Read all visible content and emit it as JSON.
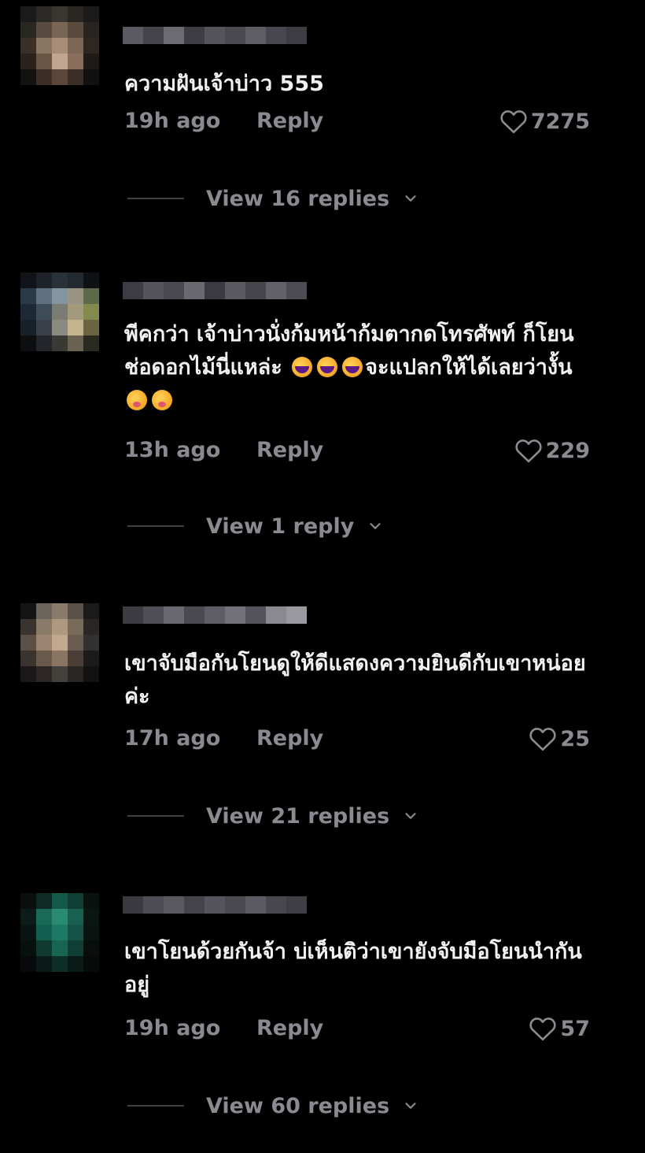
{
  "comments": [
    {
      "text": "ความฝันเจ้าบ่าว 555",
      "time": "19h ago",
      "reply_label": "Reply",
      "likes": "7275",
      "view_replies": "View 16 replies",
      "avatar_colors": [
        "#1a1a1a",
        "#2c2a27",
        "#3a3530",
        "#2a2622",
        "#1c1b1a",
        "#2a2622",
        "#5a4b40",
        "#7a6655",
        "#5b4b3e",
        "#2a2420",
        "#3a3028",
        "#8a7462",
        "#a88e78",
        "#7c6656",
        "#2e2620",
        "#2a221d",
        "#6a5444",
        "#c2a690",
        "#8a6e5c",
        "#1f1a16",
        "#141210",
        "#3c2f27",
        "#5c463a",
        "#3a2e26",
        "#121010"
      ],
      "name_colors": [
        "#5b5a62",
        "#45444a",
        "#6c6b72",
        "#3e3d44",
        "#55545a",
        "#4a4950",
        "#5e5d64",
        "#484750",
        "#3d3c42"
      ]
    },
    {
      "text": "พีคกว่า เจ้าบ่าวนั่งก้มหน้าก้มตากดโทรศัพท์ ก็โยนช่อดอกไม้นี่แหล่ะ",
      "text_emoji_tail": "จะแปลกให้ได้เลยว่างั้น",
      "time": "13h ago",
      "reply_label": "Reply",
      "likes": "229",
      "view_replies": "View 1 reply",
      "avatar_colors": [
        "#101418",
        "#1c2228",
        "#2a3138",
        "#222a30",
        "#0f1215",
        "#2b3a48",
        "#5f7080",
        "#8394a2",
        "#9a9482",
        "#5c6a4a",
        "#1d2a36",
        "#3e4c58",
        "#7a7c74",
        "#a39a7c",
        "#848a4e",
        "#182028",
        "#3a4048",
        "#8a8a80",
        "#c4b48e",
        "#6a6440",
        "#0c0e10",
        "#22262a",
        "#3a3a34",
        "#6a6250",
        "#2a2a20"
      ],
      "name_colors": [
        "#3d3c44",
        "#55545c",
        "#4a4952",
        "#6a6970",
        "#3b3a42",
        "#5a5960",
        "#46454c",
        "#62616a",
        "#4d4c54"
      ]
    },
    {
      "text": "เขาจับมือกันโยนดูให้ดีแสดงความยินดีกับเขาหน่อยค่ะ",
      "time": "17h ago",
      "reply_label": "Reply",
      "likes": "25",
      "view_replies": "View 21 replies",
      "avatar_colors": [
        "#141414",
        "#6a645c",
        "#8a7a6a",
        "#5a5048",
        "#1a1a1a",
        "#3a3430",
        "#8a7a68",
        "#b09880",
        "#7a6a5a",
        "#2a2624",
        "#5c5046",
        "#9a8470",
        "#c2a88c",
        "#6a5c50",
        "#323030",
        "#3a3430",
        "#6a5a4c",
        "#8a7462",
        "#4a3e36",
        "#1c1a1a",
        "#1a1818",
        "#2c2624",
        "#44403c",
        "#2a2624",
        "#121212"
      ],
      "name_colors": [
        "#3c3b42",
        "#4f4e56",
        "#6a6972",
        "#4a4950",
        "#5e5d66",
        "#72717a",
        "#54535c",
        "#8a8990",
        "#9a999f"
      ]
    },
    {
      "text": "เขาโยนด้วยกันจ้า บ่เห็นติว่าเขายังจับมือโยนนำกันอยู่",
      "time": "19h ago",
      "reply_label": "Reply",
      "likes": "57",
      "view_replies": "View 60 replies",
      "avatar_colors": [
        "#0a0f0e",
        "#0e2a24",
        "#145a48",
        "#0f3e34",
        "#0a1210",
        "#0c1c1a",
        "#1a6a58",
        "#2a8a72",
        "#1a6050",
        "#0a1614",
        "#0a1412",
        "#146050",
        "#1e7a64",
        "#155446",
        "#0a1412",
        "#08100e",
        "#0e3a30",
        "#166652",
        "#0e3e34",
        "#080e0c",
        "#060a0a",
        "#0a1a16",
        "#0e2e28",
        "#0a1c18",
        "#060a08"
      ],
      "name_colors": [
        "#3a3940",
        "#4d4c54",
        "#5a5960",
        "#444349",
        "#55545c",
        "#4a4950",
        "#5c5b63",
        "#48474e",
        "#3f3e45"
      ]
    }
  ],
  "colors": {
    "background": "#000000",
    "text": "#f1f1f2",
    "muted": "#8a8b91"
  }
}
